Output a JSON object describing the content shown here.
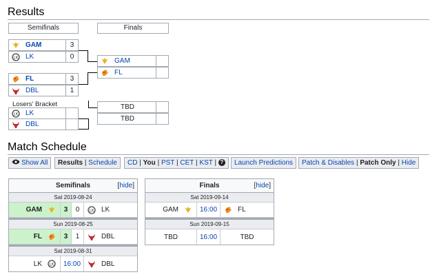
{
  "results": {
    "heading": "Results",
    "semifinals_header": "Semifinals",
    "finals_header": "Finals",
    "losers_bracket_label": "Losers' Bracket",
    "semi1": [
      {
        "team": "GAM",
        "score": "3"
      },
      {
        "team": "LK",
        "score": "0"
      }
    ],
    "semi2": [
      {
        "team": "FL",
        "score": "3"
      },
      {
        "team": "DBL",
        "score": "1"
      }
    ],
    "final": [
      {
        "team": "GAM",
        "score": ""
      },
      {
        "team": "FL",
        "score": ""
      }
    ],
    "losers": [
      {
        "team": "LK",
        "score": ""
      },
      {
        "team": "DBL",
        "score": ""
      }
    ],
    "tbd": [
      {
        "team": "TBD",
        "score": ""
      },
      {
        "team": "TBD",
        "score": ""
      }
    ]
  },
  "schedule": {
    "heading": "Match Schedule",
    "show_all": "Show All",
    "results": "Results",
    "schedule": "Schedule",
    "cd": "CD",
    "you": "You",
    "pst": "PST",
    "cet": "CET",
    "kst": "KST",
    "help": "?",
    "launch_predictions": "Launch Predictions",
    "patch_disables": "Patch & Disables",
    "patch_only": "Patch Only",
    "hide": "Hide",
    "sep": "|"
  },
  "semifinals_table": {
    "title": "Semifinals",
    "hide_label": "hide",
    "matches": [
      {
        "date": "Sat 2019-08-24",
        "team1": "GAM",
        "s1": "3",
        "s2": "0",
        "team2": "LK",
        "winner": 1
      },
      {
        "date": "Sun 2019-08-25",
        "team1": "FL",
        "s1": "3",
        "s2": "1",
        "team2": "DBL",
        "winner": 1
      },
      {
        "date": "Sat 2019-08-31",
        "team1": "LK",
        "time": "16:00",
        "team2": "DBL",
        "winner": 0
      }
    ]
  },
  "finals_table": {
    "title": "Finals",
    "hide_label": "hide",
    "matches": [
      {
        "date": "Sat 2019-09-14",
        "team1": "GAM",
        "time": "16:00",
        "team2": "FL"
      },
      {
        "date": "Sun 2019-09-15",
        "team1": "TBD",
        "time": "16:00",
        "team2": "TBD"
      }
    ]
  },
  "colors": {
    "gam": "#e6b32b",
    "lk": "#444444",
    "fl": "#f08a1c",
    "dbl": "#c0272d",
    "win": "#ccf2cc",
    "link": "#0645ad"
  }
}
